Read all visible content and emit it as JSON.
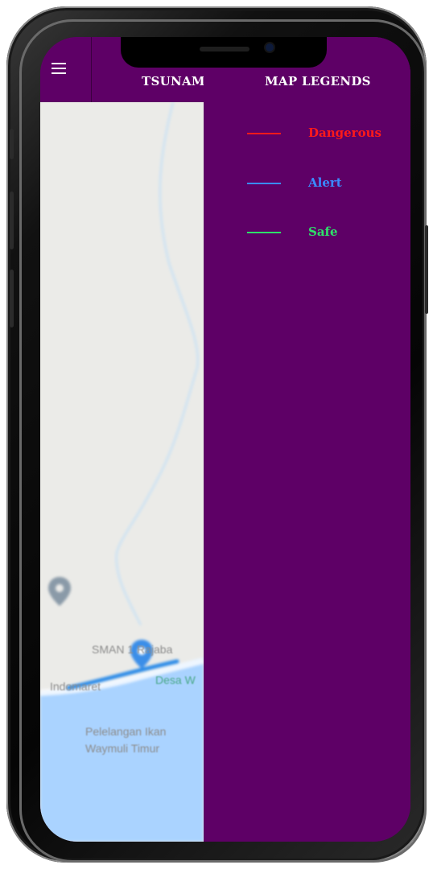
{
  "appbar": {
    "menu_icon": "hamburger-menu-icon",
    "title": "TSUNAMI"
  },
  "drawer": {
    "title": "MAP LEGENDS",
    "legends": [
      {
        "label": "Dangerous",
        "color": "#ff1a1a"
      },
      {
        "label": "Alert",
        "color": "#3a8bff"
      },
      {
        "label": "Safe",
        "color": "#2ee06a"
      }
    ]
  },
  "map": {
    "labels": {
      "school": "SMAN 1 Rajaba",
      "store": "Indomaret",
      "village": "Desa W",
      "port_line1": "Pelelangan Ikan",
      "port_line2": "Waymuli Timur"
    },
    "route_color": "#2b8be8",
    "water_color": "#aad3ff",
    "land_color": "#ebebe8",
    "pin_icon_1": "location-pin-icon",
    "pin_icon_2": "location-pin-icon"
  }
}
